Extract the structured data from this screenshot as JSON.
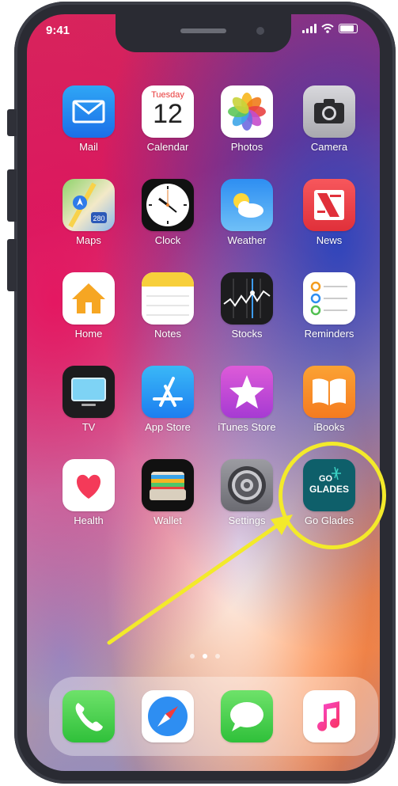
{
  "status_bar": {
    "time": "9:41"
  },
  "calendar": {
    "weekday": "Tuesday",
    "day": "12"
  },
  "apps": {
    "mail": "Mail",
    "calendar": "Calendar",
    "photos": "Photos",
    "camera": "Camera",
    "maps": "Maps",
    "clock": "Clock",
    "weather": "Weather",
    "news": "News",
    "home": "Home",
    "notes": "Notes",
    "stocks": "Stocks",
    "reminders": "Reminders",
    "tv": "TV",
    "app_store": "App Store",
    "itunes_store": "iTunes Store",
    "ibooks": "iBooks",
    "health": "Health",
    "wallet": "Wallet",
    "settings": "Settings",
    "go_glades": "Go Glades"
  },
  "go_glades_logo": {
    "line1": "GO",
    "line2": "GLADES"
  },
  "maps_shield": "280",
  "page_indicator": {
    "pages": 3,
    "current": 2
  },
  "dock": [
    "phone-icon",
    "safari-icon",
    "messages-icon",
    "music-icon"
  ],
  "annotation": {
    "color": "#f3ea2a",
    "target": "Go Glades"
  }
}
